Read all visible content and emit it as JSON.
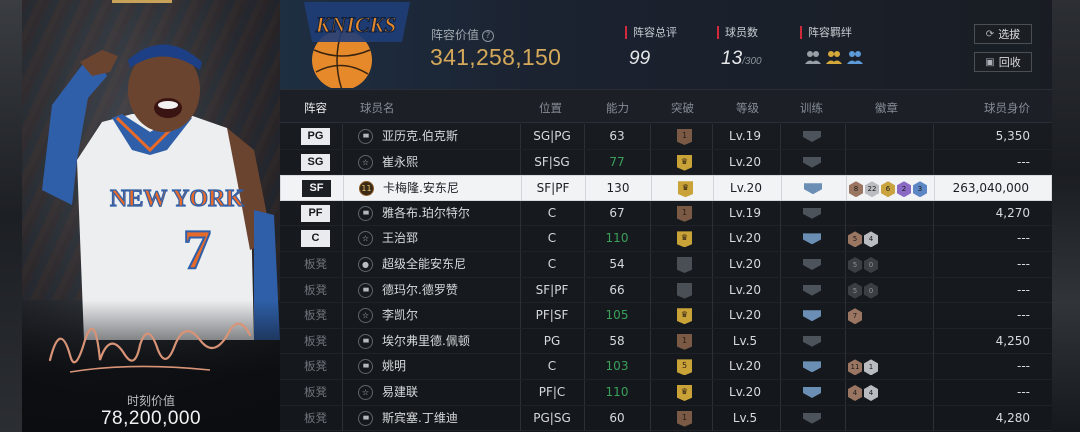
{
  "player_card": {
    "value_label": "时刻价值",
    "value": "78,200,000",
    "jersey_text": "NEW YORK",
    "jersey_number": "7"
  },
  "summary": {
    "team_logo_text": "KNICKS",
    "lineup_value_label": "阵容价值",
    "lineup_value": "341,258,150",
    "overall_label": "阵容总评",
    "overall_value": "99",
    "player_count_label": "球员数",
    "player_count": "13",
    "player_count_max": "/300",
    "bond_label": "阵容羁绊",
    "select_button": "选拔",
    "recycle_button": "回收"
  },
  "table": {
    "headers": [
      "阵容",
      "球员名",
      "位置",
      "能力",
      "突破",
      "等级",
      "训练",
      "徽章",
      "球员身价"
    ],
    "rows": [
      {
        "slot": "PG",
        "name": "亚历克.伯克斯",
        "pos": "SG|PG",
        "ability": "63",
        "ability_green": false,
        "break": "1",
        "break_color": "brown",
        "level": "Lv.19",
        "train": "gray",
        "medals": [],
        "value": "5,350",
        "type": "stats"
      },
      {
        "slot": "SG",
        "name": "崔永熙",
        "pos": "SF|SG",
        "ability": "77",
        "ability_green": true,
        "break": "",
        "break_color": "gold",
        "level": "Lv.20",
        "train": "gray",
        "medals": [],
        "value": "---",
        "type": "star"
      },
      {
        "slot": "SF",
        "name": "卡梅隆.安东尼",
        "pos": "SF|PF",
        "ability": "130",
        "ability_green": false,
        "break": "",
        "break_color": "gold",
        "level": "Lv.20",
        "train": "blue",
        "medals": [
          {
            "c": "bronze",
            "t": "8"
          },
          {
            "c": "silver",
            "t": "22"
          },
          {
            "c": "gold",
            "t": "6"
          },
          {
            "c": "purple",
            "t": "2"
          },
          {
            "c": "blue",
            "t": "3"
          }
        ],
        "value": "263,040,000",
        "type": "11",
        "highlight": true
      },
      {
        "slot": "PF",
        "name": "雅各布.珀尔特尔",
        "pos": "C",
        "ability": "67",
        "ability_green": false,
        "break": "1",
        "break_color": "brown",
        "level": "Lv.19",
        "train": "gray",
        "medals": [],
        "value": "4,270",
        "type": "stats"
      },
      {
        "slot": "C",
        "name": "王治郅",
        "pos": "C",
        "ability": "110",
        "ability_green": true,
        "break": "",
        "break_color": "gold",
        "level": "Lv.20",
        "train": "blue",
        "medals": [
          {
            "c": "bronze",
            "t": "5"
          },
          {
            "c": "silver",
            "t": "4"
          }
        ],
        "value": "---",
        "type": "star"
      },
      {
        "slot": "板凳",
        "name": "超级全能安东尼",
        "pos": "C",
        "ability": "54",
        "ability_green": false,
        "break": "",
        "break_color": "gray",
        "level": "Lv.20",
        "train": "gray",
        "medals": [
          {
            "c": "dark",
            "t": "5"
          },
          {
            "c": "dark",
            "t": "0"
          }
        ],
        "value": "---",
        "type": "person"
      },
      {
        "slot": "板凳",
        "name": "德玛尔.德罗赞",
        "pos": "SF|PF",
        "ability": "66",
        "ability_green": false,
        "break": "",
        "break_color": "gray",
        "level": "Lv.20",
        "train": "gray",
        "medals": [
          {
            "c": "dark",
            "t": "5"
          },
          {
            "c": "dark",
            "t": "0"
          }
        ],
        "value": "---",
        "type": "stats"
      },
      {
        "slot": "板凳",
        "name": "李凯尔",
        "pos": "PF|SF",
        "ability": "105",
        "ability_green": true,
        "break": "",
        "break_color": "gold",
        "level": "Lv.20",
        "train": "blue",
        "medals": [
          {
            "c": "bronze",
            "t": "7"
          }
        ],
        "value": "---",
        "type": "star"
      },
      {
        "slot": "板凳",
        "name": "埃尔弗里德.佩顿",
        "pos": "PG",
        "ability": "58",
        "ability_green": false,
        "break": "1",
        "break_color": "brown",
        "level": "Lv.5",
        "train": "gray",
        "medals": [],
        "value": "4,250",
        "type": "stats"
      },
      {
        "slot": "板凳",
        "name": "姚明",
        "pos": "C",
        "ability": "103",
        "ability_green": true,
        "break": "5",
        "break_color": "gold",
        "level": "Lv.20",
        "train": "blue",
        "medals": [
          {
            "c": "bronze",
            "t": "11"
          },
          {
            "c": "silver",
            "t": "1"
          }
        ],
        "value": "---",
        "type": "stats"
      },
      {
        "slot": "板凳",
        "name": "易建联",
        "pos": "PF|C",
        "ability": "110",
        "ability_green": true,
        "break": "",
        "break_color": "gold",
        "level": "Lv.20",
        "train": "blue",
        "medals": [
          {
            "c": "bronze",
            "t": "4"
          },
          {
            "c": "silver",
            "t": "4"
          }
        ],
        "value": "---",
        "type": "star"
      },
      {
        "slot": "板凳",
        "name": "斯宾塞.丁维迪",
        "pos": "PG|SG",
        "ability": "60",
        "ability_green": false,
        "break": "1",
        "break_color": "brown",
        "level": "Lv.5",
        "train": "gray",
        "medals": [],
        "value": "4,280",
        "type": "stats"
      }
    ]
  }
}
